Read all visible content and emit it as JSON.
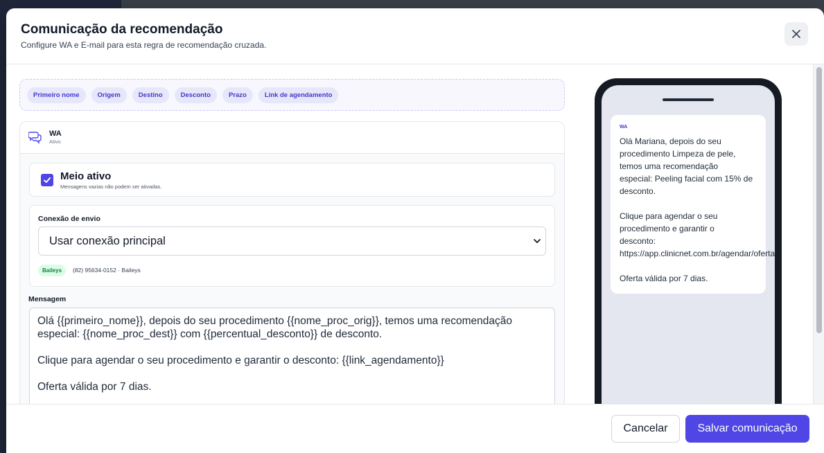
{
  "modal": {
    "title": "Comunicação da recomendação",
    "subtitle": "Configure WA e E-mail para esta regra de recomendação cruzada."
  },
  "tokens": [
    "Primeiro nome",
    "Origem",
    "Destino",
    "Desconto",
    "Prazo",
    "Link de agendamento"
  ],
  "wa": {
    "name": "WA",
    "status": "Ativo",
    "active_label": "Meio ativo",
    "active_hint": "Mensagens vazias não podem ser ativadas.",
    "active_checked": true,
    "connection_label": "Conexão de envio",
    "connection_value": "Usar conexão principal",
    "badge": "Baileys",
    "connection_info": "(82) 95634-0152 · Baileys",
    "message_label": "Mensagem",
    "message": "Olá {{primeiro_nome}}, depois do seu procedimento {{nome_proc_orig}}, temos uma recomendação especial: {{nome_proc_dest}} com {{percentual_desconto}} de desconto.\n\nClique para agendar o seu procedimento e garantir o desconto: {{link_agendamento}}\n\nOferta válida por 7 dias."
  },
  "preview": {
    "tag": "WA",
    "text": "Olá Mariana, depois do seu\nprocedimento Limpeza de pele,\ntemos uma recomendação\nespecial: Peeling facial com 15% de\ndesconto.\n\nClique para agendar o seu\nprocedimento e garantir o\ndesconto:\nhttps://app.clinicnet.com.br/agendar/oferta\n\nOferta válida por 7 dias."
  },
  "footer": {
    "cancel_label": "Cancelar",
    "save_label": "Salvar comunicação"
  },
  "colors": {
    "accent": "#4f46e5",
    "token_bg": "#e6e7fb",
    "badge_green": "#15803d"
  },
  "icons": [
    "close-icon",
    "chat-bubbles-icon",
    "check-icon",
    "chevron-down-icon"
  ]
}
